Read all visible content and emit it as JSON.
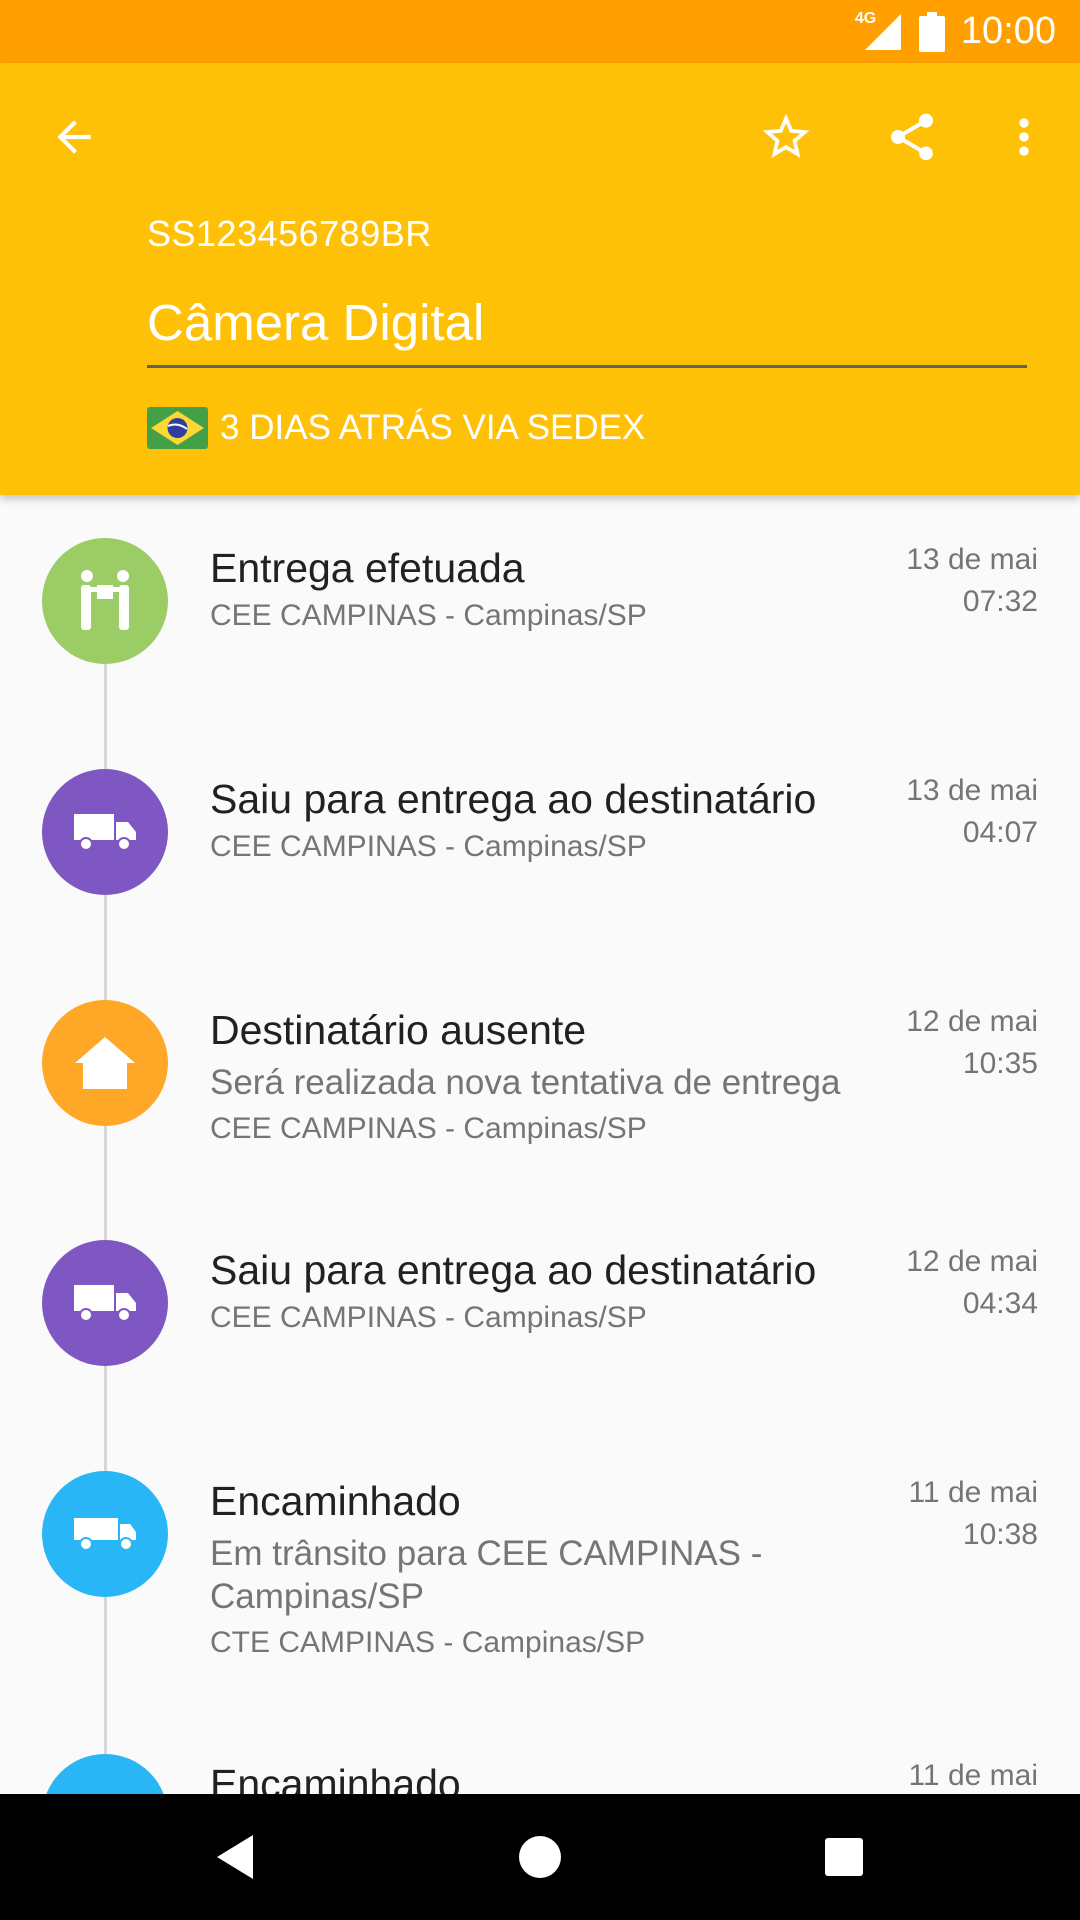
{
  "status_bar": {
    "network": "4G",
    "time": "10:00"
  },
  "app_bar": {
    "tracking_code": "SS123456789BR",
    "package_name": "Câmera Digital",
    "meta": "3 DIAS ATRÁS VIA SEDEX",
    "accent_color": "#ffc107",
    "status_color": "#ffa000"
  },
  "events": [
    {
      "title": "Entrega efetuada",
      "details": "",
      "location": "CEE CAMPINAS - Campinas/SP",
      "date": "13 de mai",
      "time": "07:32",
      "icon": "delivered-icon",
      "color": "#9ccc65"
    },
    {
      "title": "Saiu para entrega ao destinatário",
      "details": "",
      "location": "CEE CAMPINAS - Campinas/SP",
      "date": "13 de mai",
      "time": "04:07",
      "icon": "delivery-truck-icon",
      "color": "#7e57c2"
    },
    {
      "title": "Destinatário ausente",
      "details": "Será realizada nova tentativa de entrega",
      "location": "CEE CAMPINAS - Campinas/SP",
      "date": "12 de mai",
      "time": "10:35",
      "icon": "home-icon",
      "color": "#ffa726"
    },
    {
      "title": "Saiu para entrega ao destinatário",
      "details": "",
      "location": "CEE CAMPINAS - Campinas/SP",
      "date": "12 de mai",
      "time": "04:34",
      "icon": "delivery-truck-icon",
      "color": "#7e57c2"
    },
    {
      "title": "Encaminhado",
      "details": "Em trânsito para CEE CAMPINAS - Campinas/SP",
      "location": "CTE CAMPINAS - Campinas/SP",
      "date": "11 de mai",
      "time": "10:38",
      "icon": "transit-truck-icon",
      "color": "#29b6f6"
    },
    {
      "title": "Encaminhado",
      "details": "",
      "location": "",
      "date": "11 de mai",
      "time": "",
      "icon": "transit-truck-icon",
      "color": "#29b6f6"
    }
  ]
}
